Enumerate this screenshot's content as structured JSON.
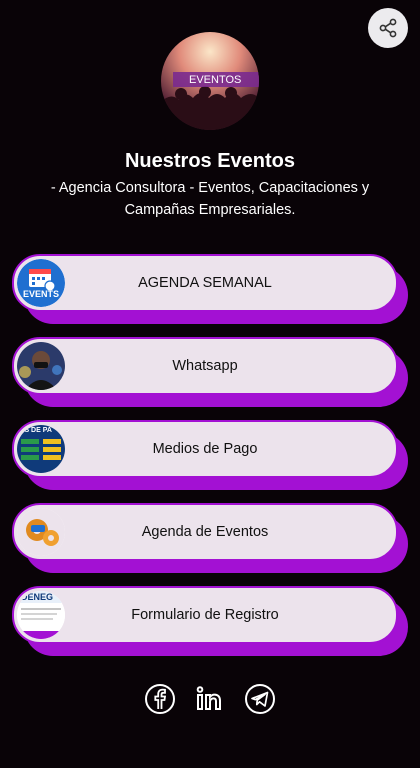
{
  "profile": {
    "image_label": "EVENTOS",
    "name": "Nuestros Eventos",
    "description": "- Agencia Consultora - Eventos, Capacitaciones y Campañas Empresariales."
  },
  "links": [
    {
      "label": "AGENDA SEMANAL",
      "thumb_text": "EVENTS",
      "thumb": "events-calendar-icon"
    },
    {
      "label": "Whatsapp",
      "thumb": "person-avatar"
    },
    {
      "label": "Medios de Pago",
      "thumb_text": "OS DE PA",
      "thumb": "payment-methods-image"
    },
    {
      "label": "Agenda de Eventos",
      "thumb": "gears-icon"
    },
    {
      "label": "Formulario de Registro",
      "thumb_text": "DENEG",
      "thumb": "form-document-image"
    }
  ],
  "socials": [
    "facebook-icon",
    "linkedin-icon",
    "telegram-icon"
  ],
  "colors": {
    "background": "#090307",
    "accent": "#a311d3",
    "button_fill": "#ece3ec"
  }
}
